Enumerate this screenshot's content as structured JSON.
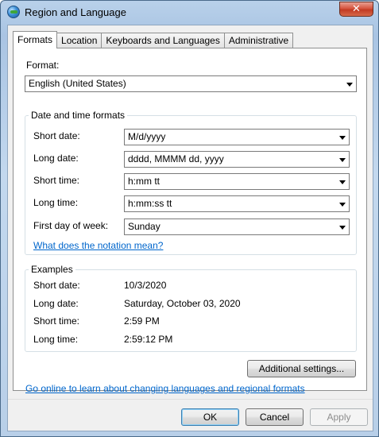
{
  "window": {
    "title": "Region and Language",
    "close_glyph": "✕"
  },
  "tabs": [
    {
      "label": "Formats",
      "active": true
    },
    {
      "label": "Location",
      "active": false
    },
    {
      "label": "Keyboards and Languages",
      "active": false
    },
    {
      "label": "Administrative",
      "active": false
    }
  ],
  "format": {
    "label": "Format:",
    "value": "English (United States)"
  },
  "datetime": {
    "group_title": "Date and time formats",
    "short_date_label": "Short date:",
    "short_date_value": "M/d/yyyy",
    "long_date_label": "Long date:",
    "long_date_value": "dddd, MMMM dd, yyyy",
    "short_time_label": "Short time:",
    "short_time_value": "h:mm tt",
    "long_time_label": "Long time:",
    "long_time_value": "h:mm:ss tt",
    "first_day_label": "First day of week:",
    "first_day_value": "Sunday",
    "notation_link": "What does the notation mean?"
  },
  "examples": {
    "group_title": "Examples",
    "short_date_label": "Short date:",
    "short_date_value": "10/3/2020",
    "long_date_label": "Long date:",
    "long_date_value": "Saturday, October 03, 2020",
    "short_time_label": "Short time:",
    "short_time_value": "2:59 PM",
    "long_time_label": "Long time:",
    "long_time_value": "2:59:12 PM"
  },
  "additional_settings_label": "Additional settings...",
  "online_link": "Go online to learn about changing languages and regional formats",
  "footer": {
    "ok_label": "OK",
    "cancel_label": "Cancel",
    "apply_label": "Apply"
  }
}
